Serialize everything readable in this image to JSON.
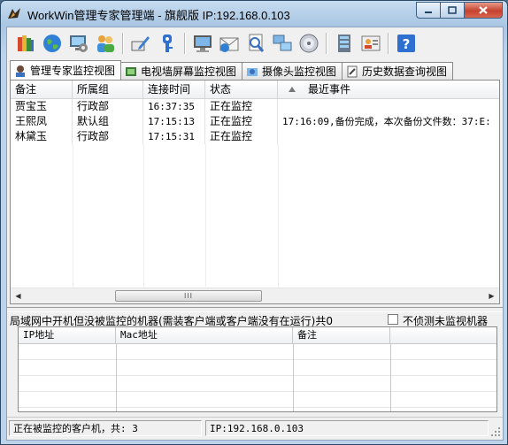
{
  "window": {
    "title": "WorkWin管理专家管理端 - 旗舰版 IP:192.168.0.103",
    "buttons": {
      "minimize": "minimize",
      "maximize": "maximize",
      "close": "close"
    }
  },
  "toolbar": {
    "icons": [
      "books-icon",
      "globe-icon",
      "monitor-settings-icon",
      "users-icon",
      "edit-pen-icon",
      "key-icon",
      "computer-icon",
      "email-icon",
      "search-document-icon",
      "network-icon",
      "cd-disc-icon",
      "server-icon",
      "id-card-icon",
      "help-icon"
    ]
  },
  "tabs": [
    {
      "label": "管理专家监控视图",
      "icon": "manager-icon",
      "active": true
    },
    {
      "label": "电视墙屏幕监控视图",
      "icon": "tv-wall-icon",
      "active": false
    },
    {
      "label": "摄像头监控视图",
      "icon": "camera-icon",
      "active": false
    },
    {
      "label": "历史数据查询视图",
      "icon": "history-icon",
      "active": false
    }
  ],
  "clients": {
    "columns": [
      "备注",
      "所属组",
      "连接时间",
      "状态",
      "最近事件"
    ],
    "rows": [
      {
        "note": "贾宝玉",
        "group": "行政部",
        "time": "16:37:35",
        "status": "正在监控",
        "event": ""
      },
      {
        "note": "王熙凤",
        "group": "默认组",
        "time": "17:15:13",
        "status": "正在监控",
        "event": "17:16:09,备份完成，本次备份文件数：37:E:"
      },
      {
        "note": "林黛玉",
        "group": "行政部",
        "time": "17:15:31",
        "status": "正在监控",
        "event": ""
      }
    ],
    "scroll_thumb": "III"
  },
  "lan": {
    "label": "局域网中开机但没被监控的机器(需装客户端或客户端没有在运行)共0",
    "checkbox_label": "不侦测未监视机器",
    "columns": [
      "IP地址",
      "Mac地址",
      "备注"
    ]
  },
  "status": {
    "left": "正在被监控的客户机，共: 3",
    "right": "IP:192.168.0.103"
  },
  "colors": {
    "title_bar": "#a9c6e3",
    "close_button": "#c6422e",
    "help_icon": "#2f6fd0"
  }
}
